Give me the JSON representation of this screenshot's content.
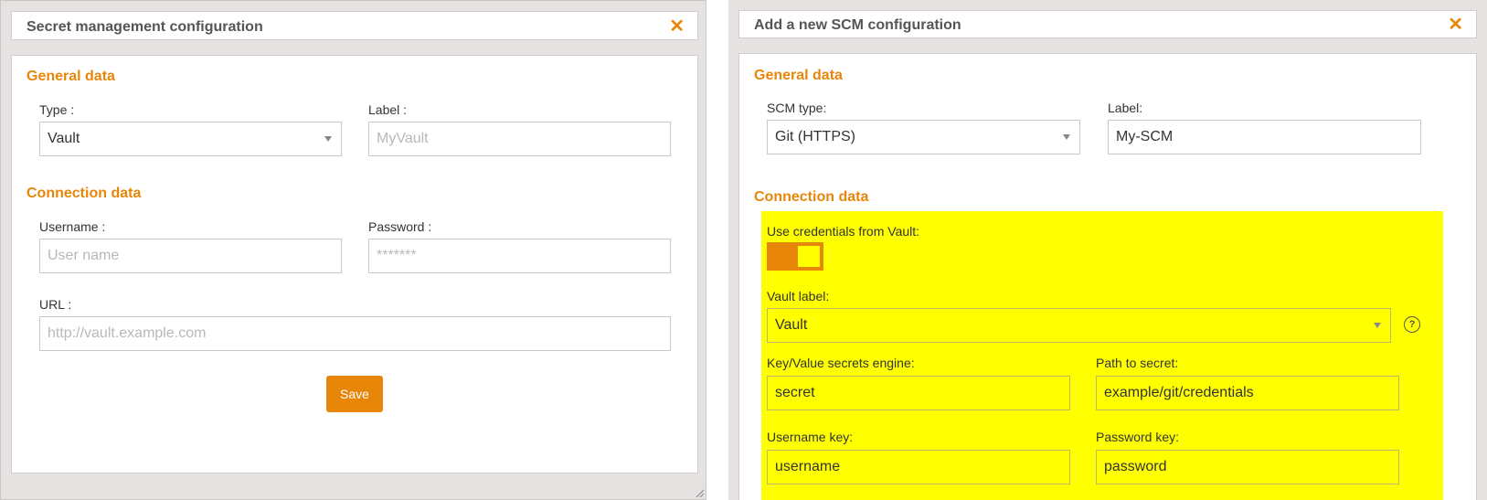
{
  "left": {
    "title": "Secret management configuration",
    "close_glyph": "✕",
    "general_title": "General data",
    "type_label": "Type :",
    "type_value": "Vault",
    "label_label": "Label :",
    "label_placeholder": "MyVault",
    "connection_title": "Connection data",
    "username_label": "Username :",
    "username_placeholder": "User name",
    "password_label": "Password :",
    "password_placeholder": "*******",
    "url_label": "URL :",
    "url_placeholder": "http://vault.example.com",
    "save_label": "Save"
  },
  "right": {
    "title": "Add a new SCM configuration",
    "close_glyph": "✕",
    "general_title": "General data",
    "scm_type_label": "SCM type:",
    "scm_type_value": "Git (HTTPS)",
    "label_label": "Label:",
    "label_value": "My-SCM",
    "connection_title": "Connection data",
    "use_credentials_label": "Use credentials from Vault:",
    "use_credentials_on": true,
    "vault_label_label": "Vault label:",
    "vault_label_value": "Vault",
    "help_glyph": "?",
    "kv_engine_label": "Key/Value secrets engine:",
    "kv_engine_value": "secret",
    "path_label": "Path to secret:",
    "path_value": "example/git/credentials",
    "username_key_label": "Username key:",
    "username_key_value": "username",
    "password_key_label": "Password key:",
    "password_key_value": "password"
  },
  "colors": {
    "accent": "#e8860a",
    "highlight": "#ffff00",
    "dialog_bg": "#e5e2e1"
  },
  "icons": {
    "close": "close-icon",
    "help": "help-icon",
    "caret": "chevron-down-icon",
    "resize": "resize-grip-icon"
  }
}
